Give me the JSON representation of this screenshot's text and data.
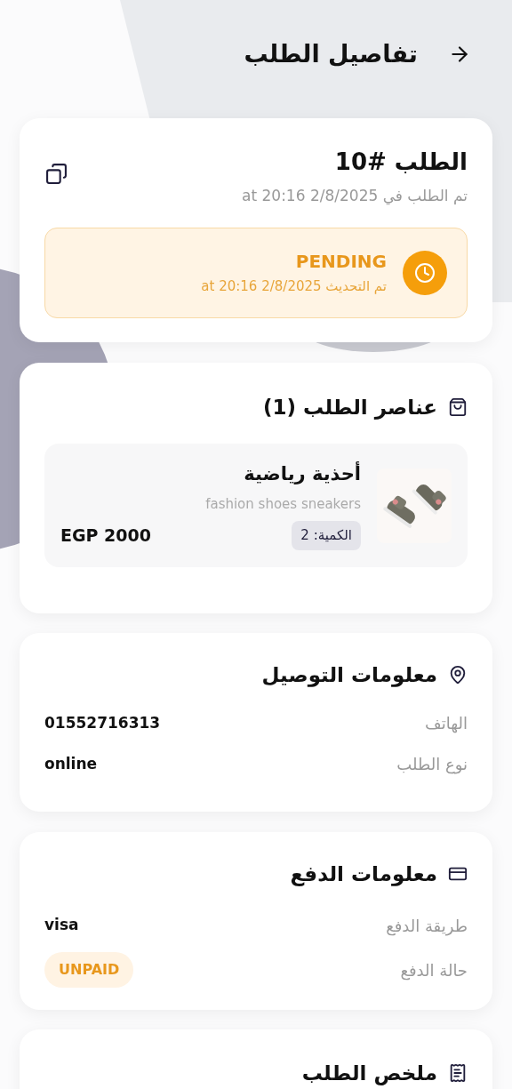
{
  "header": {
    "title": "تفاصيل الطلب"
  },
  "order": {
    "title": "الطلب #10",
    "placed": "تم الطلب في 2/8/2025 at 20:16",
    "status": {
      "kind": "pending",
      "label": "PENDING",
      "updated": "تم التحديث 2/8/2025 at 20:16"
    }
  },
  "items_section": {
    "title": "عناصر الطلب (1)",
    "items": [
      {
        "name": "أحذية رياضية",
        "description": "fashion shoes sneakers",
        "quantity": "الكمية: 2",
        "price": "EGP 2000"
      }
    ]
  },
  "delivery_section": {
    "title": "معلومات التوصيل",
    "rows": [
      {
        "label": "الهاتف",
        "value": "01552716313",
        "kind": "text"
      },
      {
        "label": "نوع الطلب",
        "value": "online",
        "kind": "text"
      }
    ]
  },
  "payment_section": {
    "title": "معلومات الدفع",
    "rows": [
      {
        "label": "طريقة الدفع",
        "value": "visa",
        "kind": "text"
      },
      {
        "label": "حالة الدفع",
        "value": "UNPAID",
        "kind": "badge"
      }
    ]
  },
  "summary_section": {
    "title": "ملخص الطلب"
  }
}
